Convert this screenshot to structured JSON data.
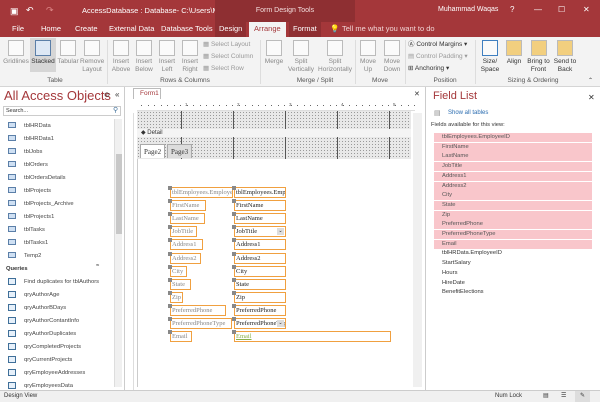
{
  "window": {
    "title": "AccessDatabase : Database- C:\\Users\\Mu...",
    "context_title": "Form Design Tools",
    "user": "Muhammad Waqas",
    "help": "?",
    "minimize": "—",
    "maximize": "☐",
    "close": "✕"
  },
  "tabs": [
    {
      "label": "File"
    },
    {
      "label": "Home"
    },
    {
      "label": "Create"
    },
    {
      "label": "External Data"
    },
    {
      "label": "Database Tools"
    },
    {
      "label": "Design"
    },
    {
      "label": "Arrange",
      "active": true
    },
    {
      "label": "Format"
    }
  ],
  "tell_me": "Tell me what you want to do",
  "ribbon": {
    "table": {
      "gridlines": "Gridlines",
      "stacked": "Stacked",
      "tabular": "Tabular",
      "remove_layout": "Remove Layout",
      "group": "Table"
    },
    "rows_columns": {
      "insert_above": "Insert Above",
      "insert_below": "Insert Below",
      "insert_left": "Insert Left",
      "insert_right": "Insert Right",
      "select_layout": "Select Layout",
      "select_column": "Select Column",
      "select_row": "Select Row",
      "group": "Rows & Columns"
    },
    "merge_split": {
      "merge": "Merge",
      "split_vertically": "Split Vertically",
      "split_horizontally": "Split Horizontally",
      "group": "Merge / Split"
    },
    "move": {
      "move_up": "Move Up",
      "move_down": "Move Down",
      "group": "Move"
    },
    "position": {
      "control_margins": "Control Margins",
      "control_padding": "Control Padding",
      "anchoring": "Anchoring",
      "group": "Position"
    },
    "sizing": {
      "size_space": "Size/ Space",
      "align": "Align",
      "bring_front": "Bring to Front",
      "send_back": "Send to Back",
      "group": "Sizing & Ordering"
    }
  },
  "nav": {
    "title": "All Access Objects",
    "search_placeholder": "Search...",
    "tables": [
      "tblHRData",
      "tblHRData1",
      "tblJobs",
      "tblOrders",
      "tblOrdersDetails",
      "tblProjects",
      "tblProjects_Archive",
      "tblProjects1",
      "tblTasks",
      "tblTasks1",
      "Temp2"
    ],
    "queries_header": "Queries",
    "queries": [
      "Find duplicates for tblAuthors",
      "qryAuthorAge",
      "qryAuthorBDays",
      "qryAuthorContantInfo",
      "qryAuthorDuplicates",
      "qryCompletedProjects",
      "qryCurrentProjects",
      "qryEmployeeAddresses",
      "qryEmployeesData"
    ]
  },
  "form": {
    "tab": "Form1",
    "detail": "Detail",
    "ruler": [
      "1",
      "2",
      "3",
      "4",
      "5"
    ],
    "pages": [
      "Page2",
      "Page3"
    ],
    "labels": [
      "tblEmployees.EmployeeID",
      "FirstName",
      "LastName",
      "JobTitle",
      "Address1",
      "Address2",
      "City",
      "State",
      "Zip",
      "PreferredPhone",
      "PreferredPhoneType",
      "Email"
    ],
    "controls": [
      "tblEmployees.EmployeeID",
      "FirstName",
      "LastName",
      "JobTitle",
      "Address1",
      "Address2",
      "City",
      "State",
      "Zip",
      "PreferredPhone",
      "PreferredPhoneType",
      "Email"
    ]
  },
  "field_list": {
    "title": "Field List",
    "show_all": "Show all tables",
    "subtitle": "Fields available for this view:",
    "highlighted": [
      "tblEmployees.EmployeeID",
      "FirstName",
      "LastName",
      "JobTitle",
      "Address1",
      "Address2",
      "City",
      "State",
      "Zip",
      "PreferredPhone",
      "PreferredPhoneType",
      "Email"
    ],
    "other": [
      "tblHRData.EmployeeID",
      "StartSalary",
      "Hours",
      "HireDate",
      "BenefitElections"
    ]
  },
  "status": {
    "left": "Design View",
    "num_lock": "Num Lock"
  },
  "colors": {
    "accent": "#a4373a",
    "selection": "#f0a040",
    "field_highlight": "#f9c6cb"
  }
}
